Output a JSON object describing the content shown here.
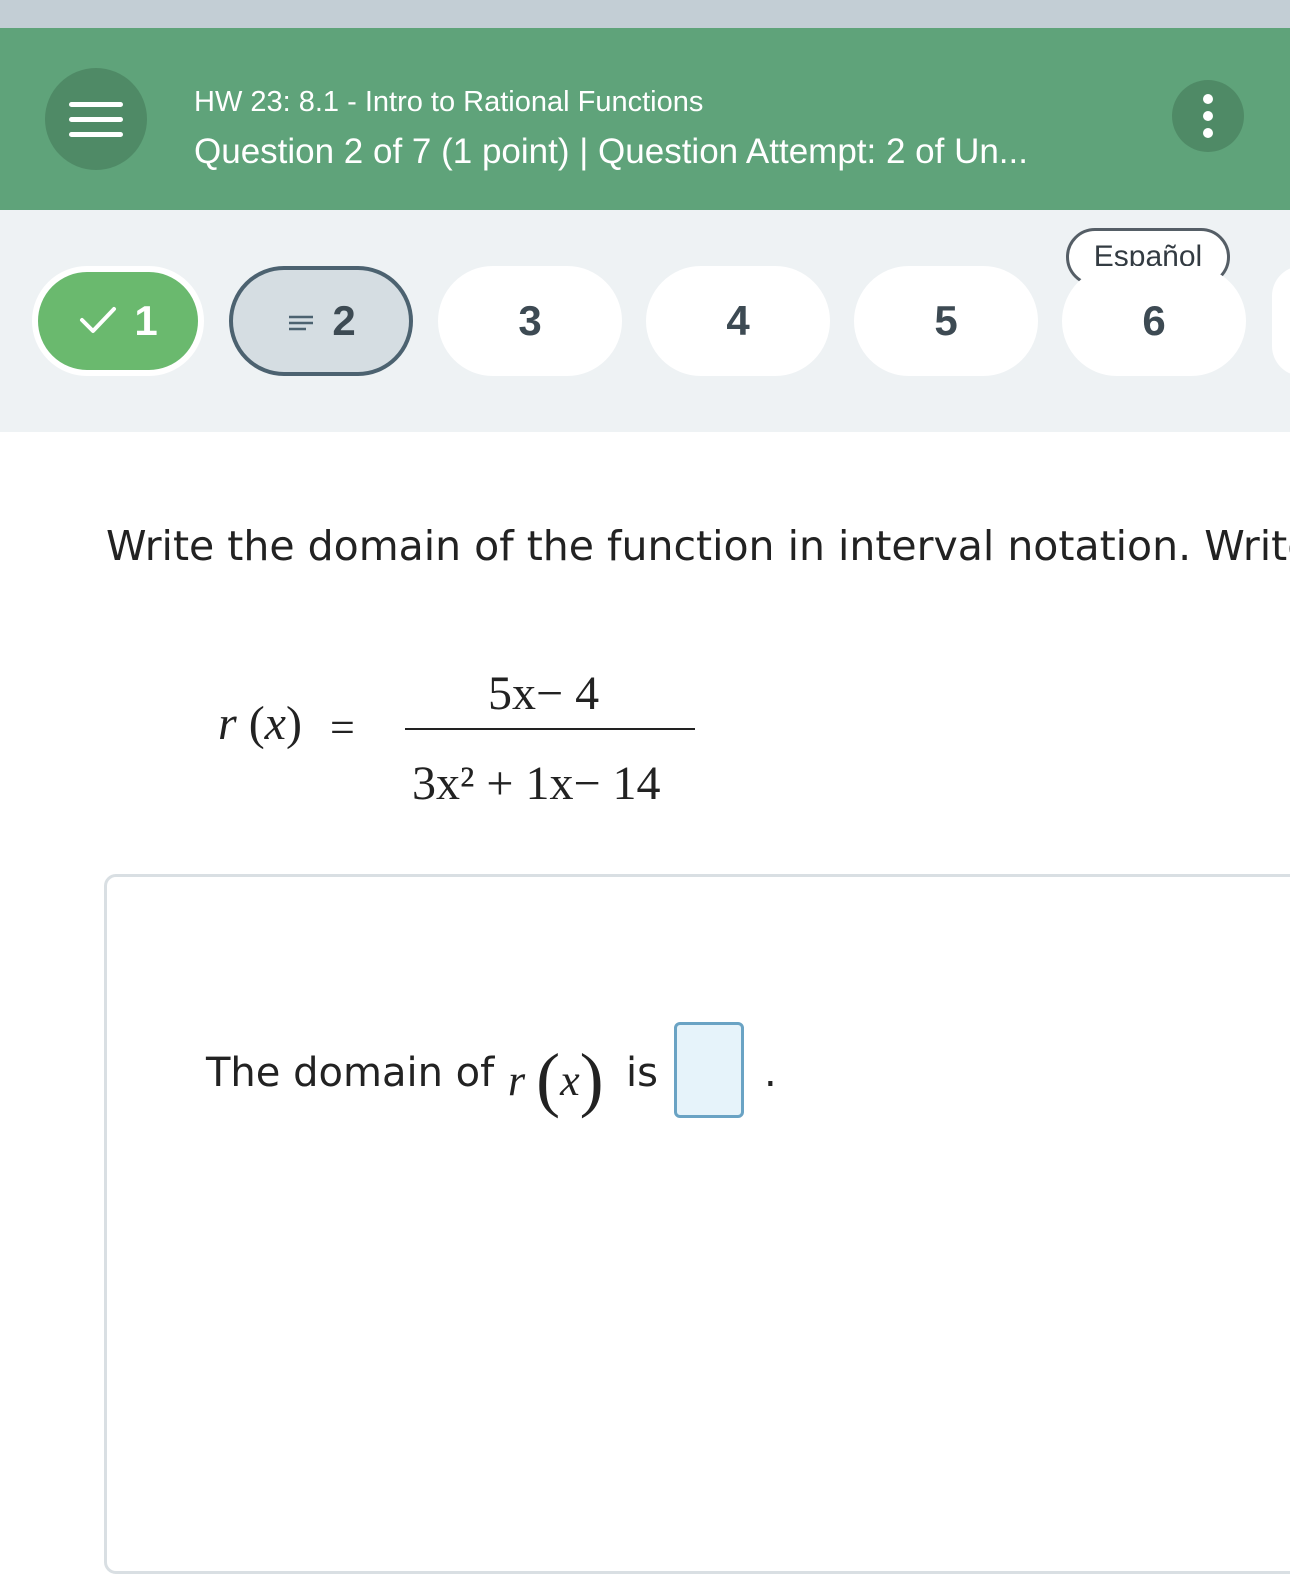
{
  "header": {
    "title": "HW 23: 8.1 - Intro to Rational Functions",
    "subtitle": "Question 2 of 7 (1 point)  |  Question Attempt: 2 of Un...",
    "menu_icon": "hamburger-menu-icon",
    "more_icon": "kebab-menu-icon",
    "bg_color": "#5fa37a"
  },
  "nav": {
    "language_label": "Español",
    "questions": [
      {
        "label": "1",
        "state": "completed",
        "icon": "check-icon"
      },
      {
        "label": "2",
        "state": "current",
        "icon": "lines-icon"
      },
      {
        "label": "3",
        "state": "unanswered"
      },
      {
        "label": "4",
        "state": "unanswered"
      },
      {
        "label": "5",
        "state": "unanswered"
      },
      {
        "label": "6",
        "state": "unanswered"
      }
    ],
    "completed_color": "#6ab96e"
  },
  "question": {
    "prompt": "Write the domain of the function in interval notation. Write",
    "function": {
      "name": "r",
      "variable": "x",
      "numerator": "5x− 4",
      "denominator": "3x² + 1x− 14"
    }
  },
  "answer": {
    "lead_text": "The domain of",
    "fn_name": "r",
    "fn_var": "x",
    "is_text": "is",
    "period": ".",
    "input_value": ""
  }
}
